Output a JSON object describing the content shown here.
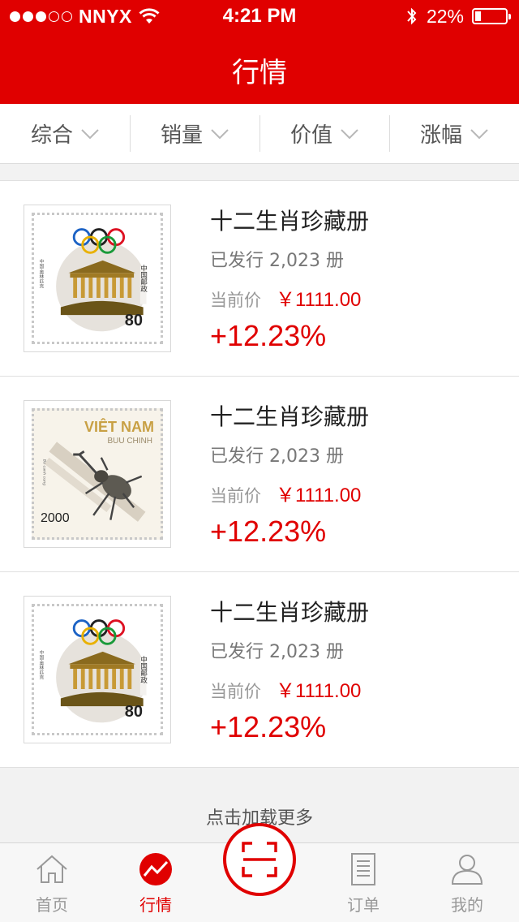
{
  "status_bar": {
    "carrier": "NNYX",
    "time": "4:21 PM",
    "battery": "22%",
    "battery_level": 0.22,
    "signal_bars": 3,
    "signal_total": 5
  },
  "nav": {
    "title": "行情"
  },
  "filters": [
    {
      "label": "综合"
    },
    {
      "label": "销量"
    },
    {
      "label": "价值"
    },
    {
      "label": "涨幅"
    }
  ],
  "items": [
    {
      "title": "十二生肖珍藏册",
      "issued": "已发行 2,023 册",
      "price_label": "当前价",
      "price": "￥1111.00",
      "change": "+12.23%",
      "stamp": "olympic",
      "stamp_value": "80"
    },
    {
      "title": "十二生肖珍藏册",
      "issued": "已发行 2,023 册",
      "price_label": "当前价",
      "price": "￥1111.00",
      "change": "+12.23%",
      "stamp": "vietnam",
      "stamp_title": "VIÊT NAM",
      "stamp_subtitle": "BUU CHINH",
      "stamp_value": "2000"
    },
    {
      "title": "十二生肖珍藏册",
      "issued": "已发行 2,023 册",
      "price_label": "当前价",
      "price": "￥1111.00",
      "change": "+12.23%",
      "stamp": "olympic",
      "stamp_value": "80"
    }
  ],
  "load_more": "点击加载更多",
  "tabs": [
    {
      "label": "首页",
      "icon": "home-icon"
    },
    {
      "label": "行情",
      "icon": "trend-icon",
      "active": true
    },
    {
      "label": "",
      "icon": "scan-icon"
    },
    {
      "label": "订单",
      "icon": "order-icon"
    },
    {
      "label": "我的",
      "icon": "user-icon"
    }
  ],
  "colors": {
    "brand": "#e00000",
    "tab_inactive": "#999999"
  }
}
